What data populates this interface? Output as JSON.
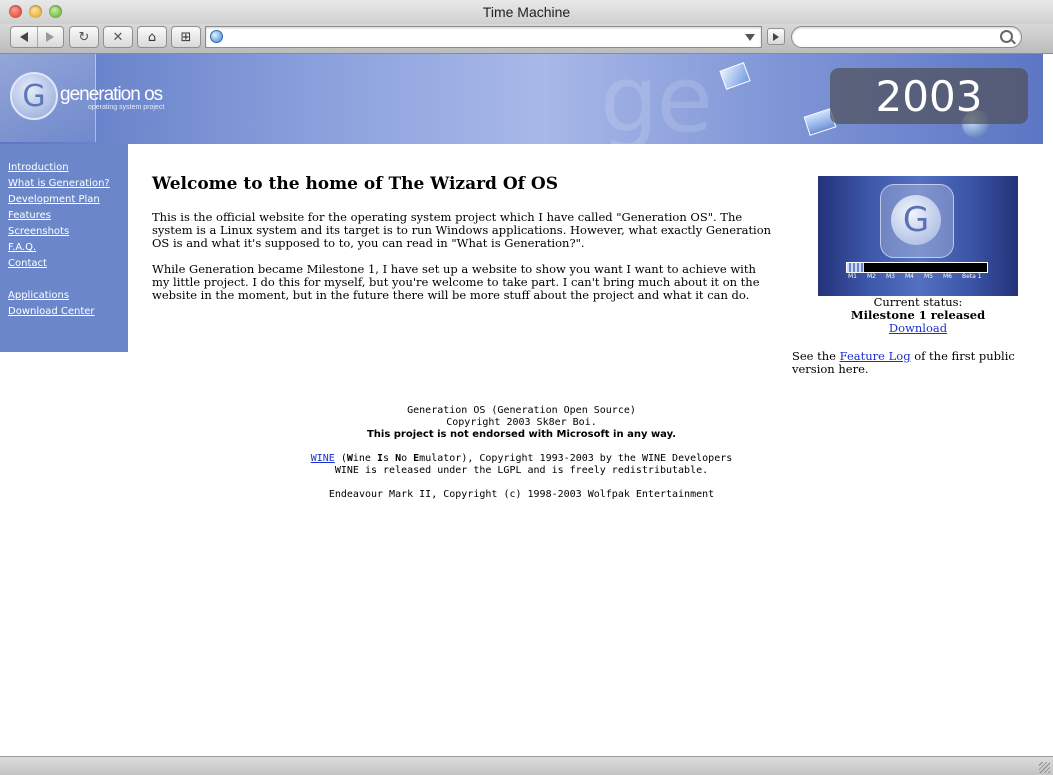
{
  "window": {
    "title": "Time Machine"
  },
  "toolbar": {
    "url": "",
    "search_placeholder": ""
  },
  "banner": {
    "brand_name": "generation os",
    "brand_tagline": "operating system project",
    "year": "2003",
    "ghost_text": "ge"
  },
  "sidebar": {
    "items": [
      {
        "label": "Introduction"
      },
      {
        "label": "What is Generation?"
      },
      {
        "label": "Development Plan"
      },
      {
        "label": "Features"
      },
      {
        "label": "Screenshots"
      },
      {
        "label": "F.A.Q."
      },
      {
        "label": "Contact"
      },
      {
        "label": "Applications"
      },
      {
        "label": "Download Center"
      }
    ]
  },
  "main": {
    "heading": "Welcome to the home of The Wizard Of OS",
    "paragraph1": "This is the official website for the operating system project which I have called \"Generation OS\". The system is a Linux system and its target is to run Windows applications. However, what exactly Generation OS is and what it's supposed to to, you can read in \"What is Generation?\".",
    "paragraph2": "While Generation became Milestone 1, I have set up a website to show you want I want to achieve with my little project. I do this for myself, but you're welcome to take part. I can't bring much about it on the website in the moment, but in the future there will be more stuff about the project and what it can do."
  },
  "status": {
    "logo_letter": "G",
    "milestones": [
      "M1",
      "M2",
      "M3",
      "M4",
      "M5",
      "M6",
      "Beta 1"
    ],
    "progress": 0.12,
    "label": "Current status:",
    "value": "Milestone 1 released",
    "download_link": "Download",
    "feature_prefix": "See the ",
    "feature_link": "Feature Log",
    "feature_suffix": " of the first public version here."
  },
  "footer": {
    "line1": "Generation OS (Generation Open Source)",
    "line2": "Copyright 2003 Sk8er Boi.",
    "line3": "This project is not endorsed with Microsoft in any way.",
    "wine_link": "WINE",
    "wine_rest": "), Copyright 1993-2003 by the WINE Developers",
    "line5": "WINE is released under the LGPL and is freely redistributable.",
    "line6": "Endeavour Mark II, Copyright (c) 1998-2003 Wolfpak Entertainment"
  },
  "icons": {
    "back": "back-arrow-icon",
    "forward": "forward-arrow-icon",
    "reload": "reload-icon",
    "stop": "stop-icon",
    "home": "home-icon",
    "add_bookmark": "add-bookmark-icon",
    "search": "magnifier-icon"
  }
}
